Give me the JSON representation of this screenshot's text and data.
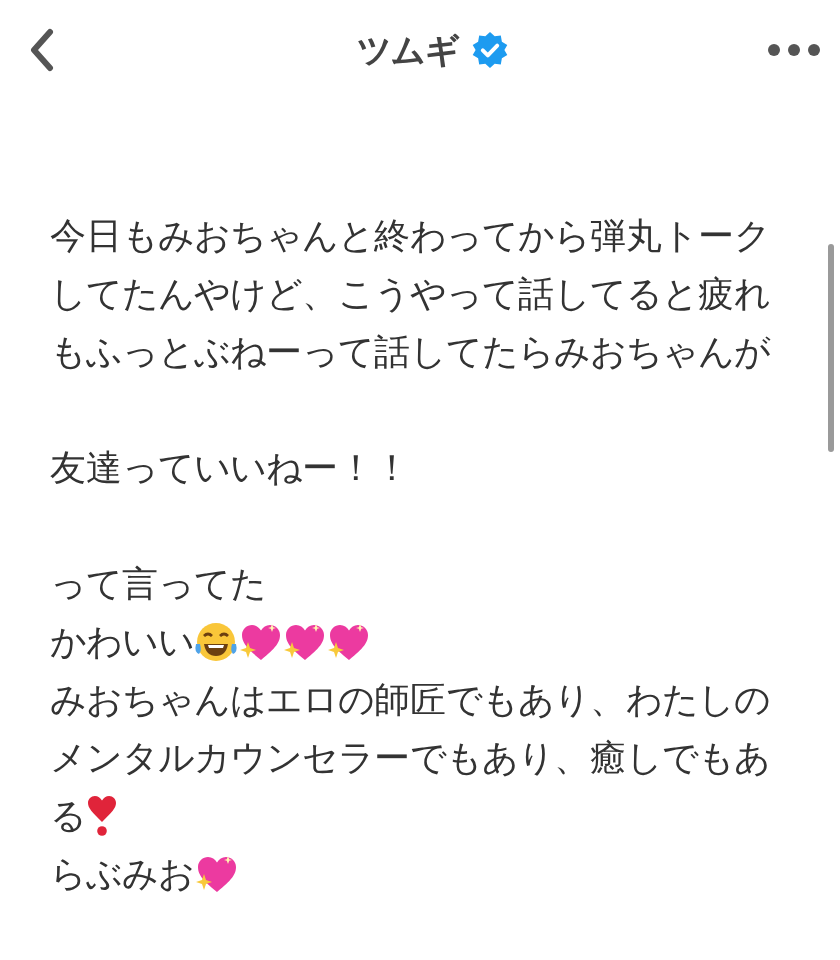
{
  "header": {
    "title": "ツムギ",
    "verified": true
  },
  "paragraphs": [
    {
      "lines": [
        {
          "text": "今日もみおちゃんと終わってから弾丸トーク"
        },
        {
          "text": "してたんやけど、こうやって話してると疲れ"
        },
        {
          "text": "もふっとぶねーって話してたらみおちゃんが"
        }
      ]
    },
    {
      "lines": [
        {
          "text": "友達っていいねー！！"
        }
      ]
    },
    {
      "lines": [
        {
          "text": "って言ってた"
        },
        {
          "text": "かわいい",
          "icons": [
            {
              "kind": "laughing"
            },
            {
              "kind": "sparkleheart"
            },
            {
              "kind": "sparkleheart"
            },
            {
              "kind": "sparkleheart"
            }
          ]
        },
        {
          "text": "みおちゃんはエロの師匠でもあり、わたしの"
        },
        {
          "text": "メンタルカウンセラーでもあり、癒しでもあ"
        },
        {
          "text": "る",
          "icons": [
            {
              "kind": "exclamation"
            }
          ]
        },
        {
          "text": "らぶみお",
          "icons": [
            {
              "kind": "sparkleheart"
            }
          ]
        }
      ]
    }
  ]
}
